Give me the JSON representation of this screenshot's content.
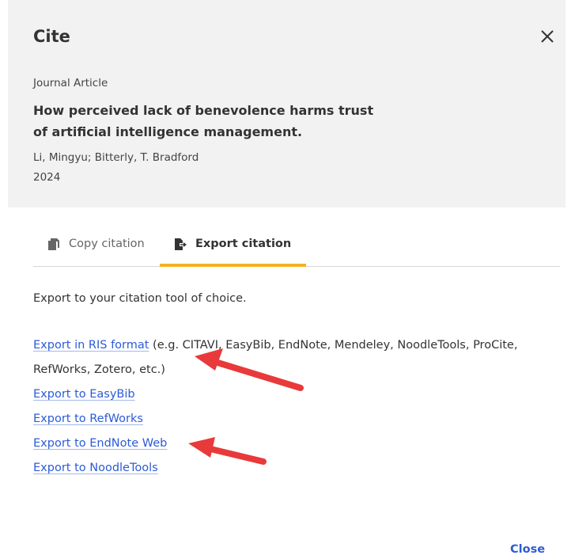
{
  "dialog": {
    "title": "Cite",
    "close_label": "Close"
  },
  "record": {
    "type": "Journal Article",
    "title_line1": "How perceived lack of benevolence harms trust",
    "title_line2": "of artificial intelligence management.",
    "authors": "Li, Mingyu; Bitterly, T. Bradford",
    "year": "2024"
  },
  "tabs": [
    {
      "label": "Copy citation",
      "icon": "copy-icon",
      "active": false
    },
    {
      "label": "Export citation",
      "icon": "export-icon",
      "active": true
    }
  ],
  "export": {
    "intro": "Export to your citation tool of choice.",
    "ris_label": "Export in RIS format",
    "ris_note_line1": " (e.g. CITAVI, EasyBib, EndNote, Mendeley, NoodleTools, ProCite,",
    "ris_note_line2": "RefWorks, Zotero, etc.)",
    "links": [
      "Export to EasyBib",
      "Export to RefWorks",
      "Export to EndNote Web",
      "Export to NoodleTools"
    ]
  },
  "colors": {
    "link": "#2c5bd7",
    "active_tab_underline": "#f2b320",
    "annotation_arrow": "#e83a3a",
    "header_background": "#f2f2f2"
  }
}
